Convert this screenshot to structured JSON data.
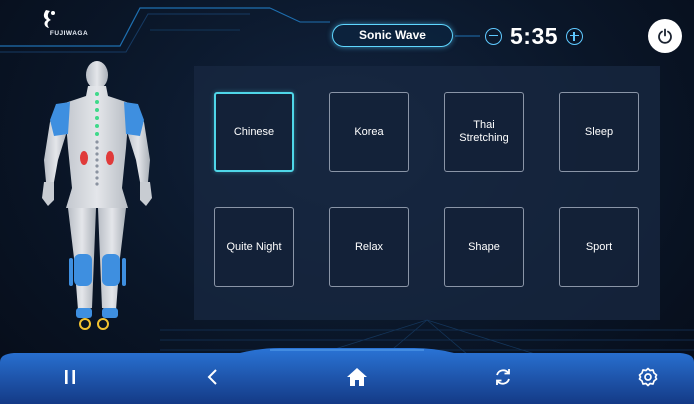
{
  "brand": {
    "logo_text": "FUJIWAGA"
  },
  "header": {
    "mode_label": "Sonic Wave",
    "timer": {
      "value": "5:35",
      "decrease_icon": "minus-circle-icon",
      "increase_icon": "plus-circle-icon"
    },
    "power_icon": "power-icon"
  },
  "body_map": {
    "description_icon": "human-body-icon",
    "accent": "#3e8fe0",
    "heat": "#e03a3a",
    "points": "#3fd98a"
  },
  "modes": [
    {
      "label": "Chinese",
      "selected": true
    },
    {
      "label": "Korea",
      "selected": false
    },
    {
      "label": "Thai\nStretching",
      "selected": false
    },
    {
      "label": "Sleep",
      "selected": false
    },
    {
      "label": "Quite Night",
      "selected": false
    },
    {
      "label": "Relax",
      "selected": false
    },
    {
      "label": "Shape",
      "selected": false
    },
    {
      "label": "Sport",
      "selected": false
    }
  ],
  "bottom_nav": [
    {
      "name": "pause-icon"
    },
    {
      "name": "back-chevron-icon"
    },
    {
      "name": "home-icon"
    },
    {
      "name": "refresh-icon"
    },
    {
      "name": "settings-icon"
    }
  ],
  "colors": {
    "accent": "#5fd7ff",
    "selected_border": "#4fd6e8",
    "bar": "#1f5fc4"
  }
}
